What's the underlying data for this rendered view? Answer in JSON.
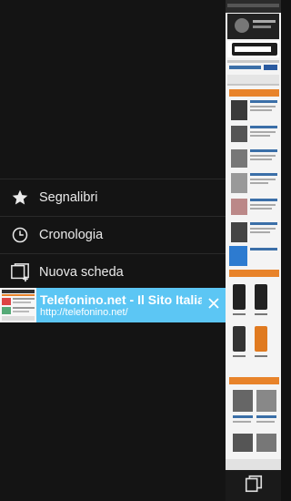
{
  "menu": {
    "items": [
      {
        "label": "Segnalibri",
        "icon": "star-icon"
      },
      {
        "label": "Cronologia",
        "icon": "clock-icon"
      },
      {
        "label": "Nuova scheda",
        "icon": "new-tab-icon"
      }
    ]
  },
  "tab": {
    "title": "Telefonino.net - Il Sito Italiano",
    "url": "http://telefonino.net/"
  },
  "preview": {
    "logo_text": "telefonino"
  },
  "colors": {
    "accent": "#5cc6f4",
    "drawer_bg": "#141414",
    "page_orange": "#e8832a"
  }
}
